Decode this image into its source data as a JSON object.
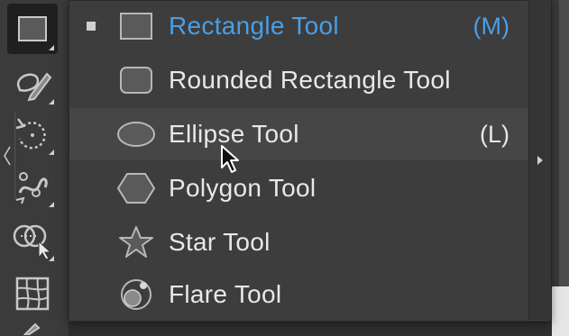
{
  "toolbar": {
    "tools": [
      {
        "name": "rectangle-tool",
        "icon": "rectangle-icon",
        "active": true
      },
      {
        "name": "shaper-tool",
        "icon": "shaper-pencil-icon",
        "active": false
      },
      {
        "name": "rotate-tool",
        "icon": "rotate-icon",
        "active": false
      },
      {
        "name": "puppet-warp-tool",
        "icon": "puppet-warp-icon",
        "active": false
      },
      {
        "name": "shape-builder-tool",
        "icon": "shape-builder-icon",
        "active": false
      },
      {
        "name": "perspective-grid-tool",
        "icon": "perspective-grid-icon",
        "active": false
      }
    ]
  },
  "flyout": {
    "items": [
      {
        "label": "Rectangle Tool",
        "shortcut": "(M)",
        "icon": "rectangle-icon",
        "selected": true,
        "hover": false
      },
      {
        "label": "Rounded Rectangle Tool",
        "shortcut": "",
        "icon": "rounded-rectangle-icon",
        "selected": false,
        "hover": false
      },
      {
        "label": "Ellipse Tool",
        "shortcut": "(L)",
        "icon": "ellipse-icon",
        "selected": false,
        "hover": true
      },
      {
        "label": "Polygon Tool",
        "shortcut": "",
        "icon": "polygon-icon",
        "selected": false,
        "hover": false
      },
      {
        "label": "Star Tool",
        "shortcut": "",
        "icon": "star-icon",
        "selected": false,
        "hover": false
      },
      {
        "label": "Flare Tool",
        "shortcut": "",
        "icon": "flare-icon",
        "selected": false,
        "hover": false
      }
    ]
  },
  "colors": {
    "selected_text": "#4a9ee4",
    "menu_text": "#e8e8e8",
    "menu_bg": "#3d3d3d",
    "hover_bg": "#464646"
  }
}
